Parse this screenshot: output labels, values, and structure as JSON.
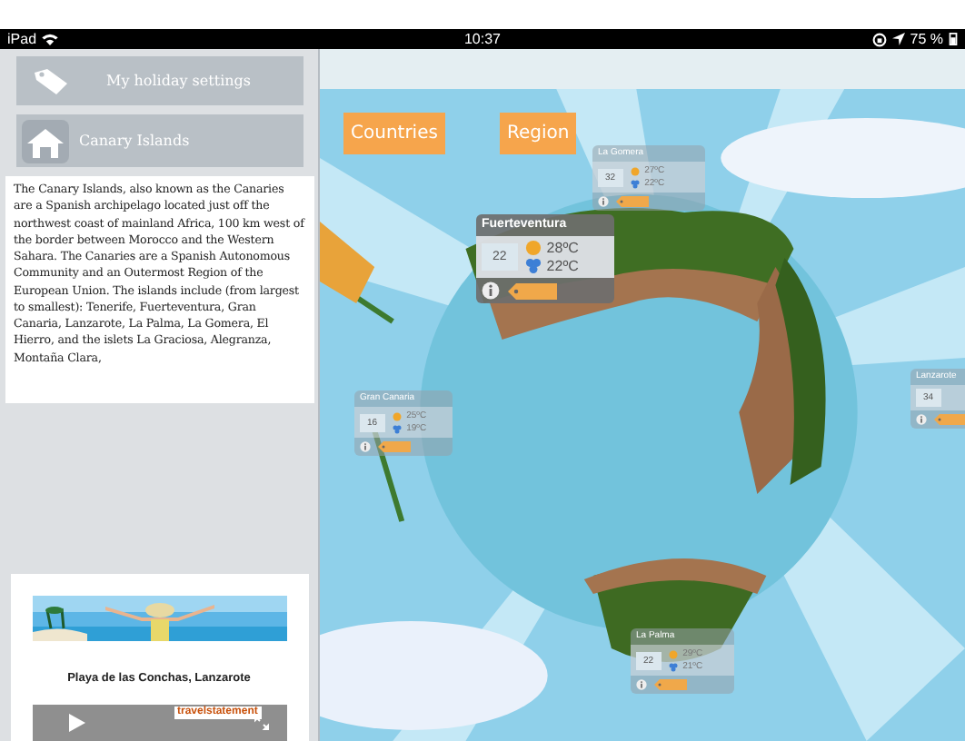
{
  "status_bar": {
    "device": "iPad",
    "time": "10:37",
    "battery": "75 %"
  },
  "sidebar": {
    "items": [
      {
        "label": "My holiday settings",
        "kind": "tag"
      },
      {
        "label": "Canary Islands",
        "kind": "house"
      }
    ],
    "description": "The Canary Islands, also known as the Canaries are a Spanish archipelago located just off the northwest coast of mainland Africa, 100 km west of the border between Morocco and the Western Sahara. The Canaries are a Spanish Autonomous Community and an Outermost Region of the European Union. The islands include (from largest to smallest): Tenerife, Fuerteventura, Gran Canaria, Lanzarote, La Palma, La Gomera, El Hierro, and the islets La Graciosa, Alegranza, Montaña Clara,",
    "video": {
      "caption": "Playa de las Conchas, Lanzarote",
      "logo": "travelstatement"
    }
  },
  "map": {
    "tabs": [
      {
        "label": "Countries"
      },
      {
        "label": "Region"
      }
    ],
    "islands": [
      {
        "name": "La Gomera",
        "count": "32",
        "high": "27ºC",
        "low": "22ºC",
        "faded": true
      },
      {
        "name": "Fuerteventura",
        "count": "22",
        "high": "28ºC",
        "low": "22ºC",
        "faded": false
      },
      {
        "name": "Gran Canaria",
        "count": "16",
        "high": "25ºC",
        "low": "19ºC",
        "faded": true
      },
      {
        "name": "Lanzarote",
        "count": "34",
        "faded": true
      },
      {
        "name": "La Palma",
        "count": "22",
        "high": "29ºC",
        "low": "21ºC",
        "faded": true
      }
    ]
  }
}
